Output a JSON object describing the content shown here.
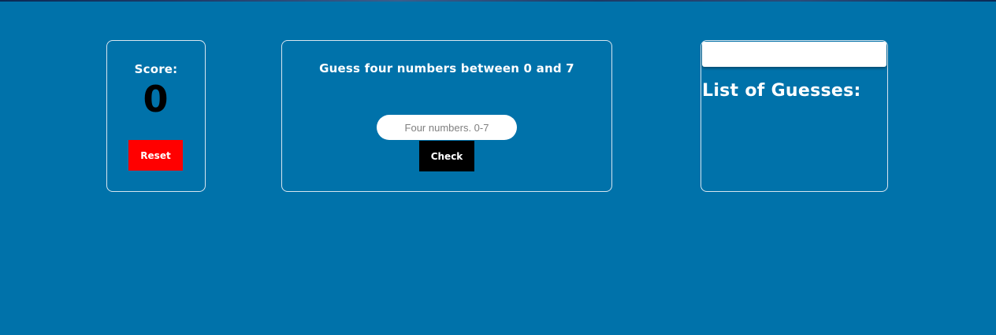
{
  "score": {
    "label": "Score:",
    "value": "0",
    "reset_label": "Reset"
  },
  "game": {
    "title": "Guess four numbers between 0 and 7",
    "input_placeholder": "Four numbers. 0-7",
    "input_value": "",
    "check_label": "Check"
  },
  "guesses": {
    "header_value": "",
    "title": "List of Guesses:",
    "items": []
  },
  "colors": {
    "background": "#0072aa",
    "reset_button": "#ff0000",
    "check_button": "#000000",
    "panel_border": "#d8e6f0"
  }
}
